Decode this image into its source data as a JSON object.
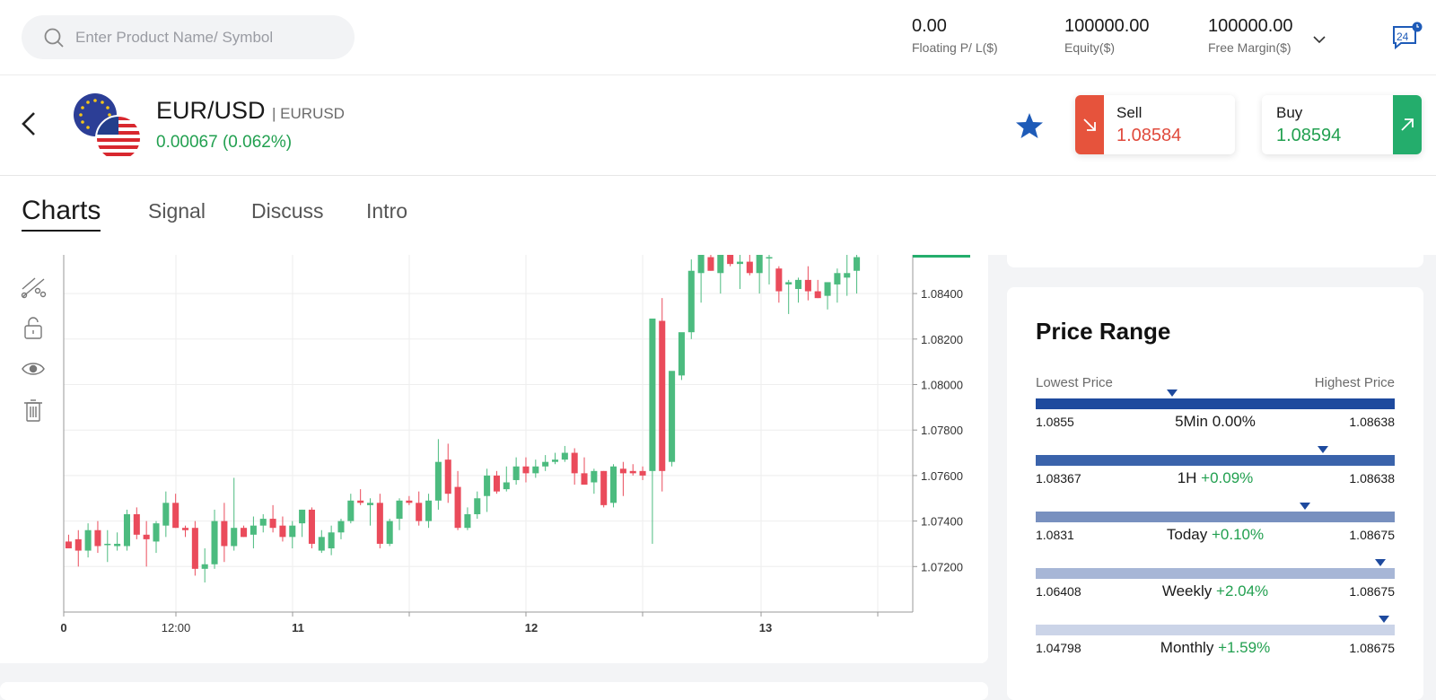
{
  "search": {
    "placeholder": "Enter Product Name/ Symbol"
  },
  "account": {
    "floating_value": "0.00",
    "floating_label": "Floating P/ L($)",
    "equity_value": "100000.00",
    "equity_label": "Equity($)",
    "margin_value": "100000.00",
    "margin_label": "Free Margin($)",
    "chat_badge": "24"
  },
  "product": {
    "pair": "EUR/USD",
    "symbol": "| EURUSD",
    "change": "0.00067 (0.062%)"
  },
  "trade": {
    "sell_label": "Sell",
    "sell_price": "1.08584",
    "buy_label": "Buy",
    "buy_price": "1.08594"
  },
  "tabs": [
    {
      "label": "Charts",
      "active": true
    },
    {
      "label": "Signal",
      "active": false
    },
    {
      "label": "Discuss",
      "active": false
    },
    {
      "label": "Intro",
      "active": false
    }
  ],
  "chart_data": {
    "type": "candlestick",
    "y_ticks": [
      "1.08400",
      "1.08200",
      "1.08000",
      "1.07800",
      "1.07600",
      "1.07400",
      "1.07200"
    ],
    "x_ticks": [
      "0",
      "12:00",
      "11",
      "12",
      "13"
    ],
    "ylim": [
      1.07,
      1.0857
    ],
    "colors": {
      "up": "#4cbb7f",
      "down": "#ea4b5b"
    },
    "candles": [
      [
        1.0731,
        1.0734,
        1.0729,
        1.0728
      ],
      [
        1.0732,
        1.0736,
        1.072,
        1.0727
      ],
      [
        1.0727,
        1.0739,
        1.0724,
        1.0736
      ],
      [
        1.0736,
        1.074,
        1.0726,
        1.0729
      ],
      [
        1.073,
        1.0736,
        1.0722,
        1.073
      ],
      [
        1.0729,
        1.0735,
        1.0727,
        1.073
      ],
      [
        1.0729,
        1.0745,
        1.0727,
        1.0743
      ],
      [
        1.0743,
        1.0746,
        1.0732,
        1.0734
      ],
      [
        1.0734,
        1.074,
        1.072,
        1.0732
      ],
      [
        1.0731,
        1.074,
        1.0726,
        1.0739
      ],
      [
        1.0738,
        1.0753,
        1.0733,
        1.0748
      ],
      [
        1.0748,
        1.0752,
        1.0737,
        1.0737
      ],
      [
        1.0737,
        1.0738,
        1.0733,
        1.0736
      ],
      [
        1.0737,
        1.074,
        1.0716,
        1.0719
      ],
      [
        1.0719,
        1.0728,
        1.0713,
        1.0721
      ],
      [
        1.0721,
        1.0745,
        1.0719,
        1.074
      ],
      [
        1.074,
        1.0748,
        1.0722,
        1.0729
      ],
      [
        1.0729,
        1.0759,
        1.0727,
        1.0737
      ],
      [
        1.0737,
        1.0738,
        1.0733,
        1.0733
      ],
      [
        1.0734,
        1.0742,
        1.0728,
        1.0738
      ],
      [
        1.0738,
        1.0743,
        1.0735,
        1.0741
      ],
      [
        1.0741,
        1.0747,
        1.0735,
        1.0737
      ],
      [
        1.0738,
        1.0742,
        1.0731,
        1.0733
      ],
      [
        1.0733,
        1.074,
        1.0728,
        1.0738
      ],
      [
        1.0739,
        1.0745,
        1.0733,
        1.0745
      ],
      [
        1.0745,
        1.0746,
        1.0728,
        1.073
      ],
      [
        1.0727,
        1.0736,
        1.0726,
        1.0733
      ],
      [
        1.0728,
        1.0738,
        1.0725,
        1.0735
      ],
      [
        1.0735,
        1.0741,
        1.0732,
        1.074
      ],
      [
        1.074,
        1.0752,
        1.0739,
        1.0749
      ],
      [
        1.0749,
        1.0754,
        1.0747,
        1.0748
      ],
      [
        1.0747,
        1.075,
        1.0738,
        1.0748
      ],
      [
        1.0748,
        1.0752,
        1.0728,
        1.073
      ],
      [
        1.073,
        1.0741,
        1.0729,
        1.074
      ],
      [
        1.0741,
        1.075,
        1.0736,
        1.0749
      ],
      [
        1.0749,
        1.0751,
        1.0747,
        1.0748
      ],
      [
        1.0748,
        1.0753,
        1.0738,
        1.074
      ],
      [
        1.074,
        1.0752,
        1.0737,
        1.0749
      ],
      [
        1.0749,
        1.0776,
        1.0745,
        1.0766
      ],
      [
        1.0767,
        1.0774,
        1.0748,
        1.0752
      ],
      [
        1.0755,
        1.0762,
        1.0736,
        1.0737
      ],
      [
        1.0737,
        1.0746,
        1.0736,
        1.0743
      ],
      [
        1.0743,
        1.0753,
        1.0741,
        1.075
      ],
      [
        1.0751,
        1.0763,
        1.0744,
        1.076
      ],
      [
        1.076,
        1.0762,
        1.0752,
        1.0753
      ],
      [
        1.0754,
        1.0764,
        1.0753,
        1.0757
      ],
      [
        1.0758,
        1.0768,
        1.0756,
        1.0764
      ],
      [
        1.0764,
        1.0768,
        1.0757,
        1.0761
      ],
      [
        1.0761,
        1.0767,
        1.0759,
        1.0764
      ],
      [
        1.0764,
        1.0769,
        1.0762,
        1.0766
      ],
      [
        1.0766,
        1.077,
        1.0765,
        1.0767
      ],
      [
        1.0767,
        1.0773,
        1.0766,
        1.077
      ],
      [
        1.077,
        1.0772,
        1.0756,
        1.0761
      ],
      [
        1.0761,
        1.0768,
        1.0756,
        1.0756
      ],
      [
        1.0757,
        1.0763,
        1.0752,
        1.0762
      ],
      [
        1.0762,
        1.0762,
        1.0746,
        1.0747
      ],
      [
        1.0748,
        1.0765,
        1.0746,
        1.0764
      ],
      [
        1.0763,
        1.0766,
        1.0751,
        1.0761
      ],
      [
        1.0762,
        1.0765,
        1.076,
        1.0761
      ],
      [
        1.0762,
        1.0764,
        1.0758,
        1.076
      ],
      [
        1.0762,
        1.0764,
        1.073,
        1.0829
      ],
      [
        1.0828,
        1.0838,
        1.0753,
        1.0762
      ],
      [
        1.0766,
        1.0776,
        1.0764,
        1.0806
      ],
      [
        1.0804,
        1.0822,
        1.0802,
        1.0823
      ],
      [
        1.0823,
        1.0855,
        1.082,
        1.085
      ],
      [
        1.0849,
        1.0857,
        1.0836,
        1.0857
      ],
      [
        1.0856,
        1.0857,
        1.085,
        1.085
      ],
      [
        1.0849,
        1.0857,
        1.084,
        1.0857
      ],
      [
        1.0857,
        1.086,
        1.0852,
        1.0853
      ],
      [
        1.0853,
        1.086,
        1.0842,
        1.0854
      ],
      [
        1.0854,
        1.0859,
        1.0848,
        1.0849
      ],
      [
        1.0849,
        1.0857,
        1.084,
        1.0857
      ],
      [
        1.0856,
        1.086,
        1.0844,
        1.0856
      ],
      [
        1.0851,
        1.0852,
        1.0836,
        1.0841
      ],
      [
        1.0844,
        1.0846,
        1.0831,
        1.0845
      ],
      [
        1.0842,
        1.0847,
        1.0836,
        1.0846
      ],
      [
        1.0846,
        1.0852,
        1.0837,
        1.0841
      ],
      [
        1.0841,
        1.0846,
        1.0838,
        1.0838
      ],
      [
        1.0839,
        1.0844,
        1.0833,
        1.0845
      ],
      [
        1.0844,
        1.0851,
        1.0836,
        1.0849
      ],
      [
        1.0847,
        1.0857,
        1.0839,
        1.0849
      ],
      [
        1.085,
        1.0858,
        1.084,
        1.0856
      ]
    ],
    "current_price": "1.08584"
  },
  "price_range": {
    "title": "Price Range",
    "lowest_label": "Lowest Price",
    "highest_label": "Highest Price",
    "rows": [
      {
        "period": "5Min",
        "change": "0.00%",
        "low": "1.0855",
        "high": "1.08638",
        "marker": 0.38,
        "color": "#1e4a9e",
        "positive": false
      },
      {
        "period": "1H",
        "change": "+0.09%",
        "low": "1.08367",
        "high": "1.08638",
        "marker": 0.8,
        "color": "#3a63ab",
        "positive": true
      },
      {
        "period": "Today",
        "change": "+0.10%",
        "low": "1.0831",
        "high": "1.08675",
        "marker": 0.75,
        "color": "#7890bf",
        "positive": true
      },
      {
        "period": "Weekly",
        "change": "+2.04%",
        "low": "1.06408",
        "high": "1.08675",
        "marker": 0.96,
        "color": "#a7b6d6",
        "positive": true
      },
      {
        "period": "Monthly",
        "change": "+1.59%",
        "low": "1.04798",
        "high": "1.08675",
        "marker": 0.97,
        "color": "#cbd4e8",
        "positive": true
      }
    ]
  }
}
